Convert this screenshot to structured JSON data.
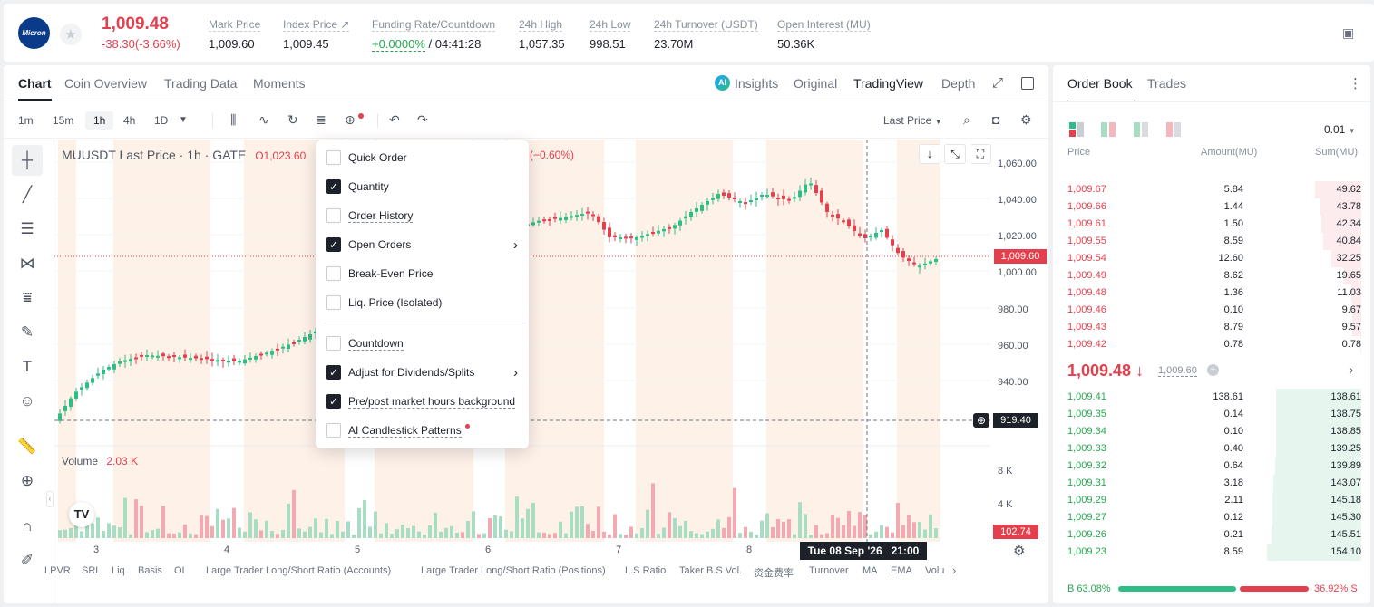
{
  "ticker": {
    "logo_text": "Micron",
    "last_price": "1,009.48",
    "change": "-38.30(-3.66%)",
    "stats": [
      {
        "label": "Mark Price",
        "value": "1,009.60"
      },
      {
        "label": "Index Price ↗",
        "value": "1,009.45"
      },
      {
        "label": "Funding Rate/Countdown",
        "value_green": "+0.0000%",
        "value_rest": " / 04:41:28"
      },
      {
        "label": "24h High",
        "value": "1,057.35"
      },
      {
        "label": "24h Low",
        "value": "998.51"
      },
      {
        "label": "24h Turnover (USDT)",
        "value": "23.70M"
      },
      {
        "label": "Open Interest (MU)",
        "value": "50.36K"
      }
    ]
  },
  "chart_tabs": [
    "Chart",
    "Coin Overview",
    "Trading Data",
    "Moments"
  ],
  "view_tabs": {
    "insights": "Insights",
    "original": "Original",
    "tradingview": "TradingView",
    "depth": "Depth"
  },
  "timeframes": [
    "1m",
    "15m",
    "1h",
    "4h",
    "1D"
  ],
  "price_type": "Last Price",
  "legend": {
    "symbol": "MUUSDT Last Price · 1h · GATE",
    "open": "O1,023.60",
    "change": "(−0.60%)",
    "volume_label": "Volume",
    "volume_value": "2.03 K"
  },
  "y_axis": [
    "1,060.00",
    "1,040.00",
    "1,020.00",
    "1,000.00",
    "980.00",
    "960.00",
    "940.00"
  ],
  "volume_axis": [
    "8 K",
    "4 K"
  ],
  "price_tags": {
    "last": "1,009.60",
    "cross": "919.40",
    "volume": "102.74"
  },
  "x_axis": [
    "3",
    "4",
    "5",
    "6",
    "7",
    "8"
  ],
  "crosshair_time": "Tue 08 Sep '26   21:00",
  "indicators": [
    "LPVR",
    "SRL",
    "Liq",
    "Basis",
    "OI",
    "Large Trader Long/Short Ratio (Accounts)",
    "Large Trader Long/Short Ratio (Positions)",
    "L.S Ratio",
    "Taker B.S Vol.",
    "资金费率",
    "Turnover",
    "MA",
    "EMA",
    "Volu"
  ],
  "menu": [
    {
      "label": "Quick Order",
      "checked": false
    },
    {
      "label": "Quantity",
      "checked": true
    },
    {
      "label": "Order History",
      "checked": false
    },
    {
      "label": "Open Orders",
      "checked": true
    },
    {
      "label": "Break-Even Price",
      "checked": false
    },
    {
      "label": "Liq. Price (Isolated)",
      "checked": false
    },
    {
      "label": "Countdown",
      "checked": false
    },
    {
      "label": "Adjust for Dividends/Splits",
      "checked": true
    },
    {
      "label": "Pre/post market hours background",
      "checked": true
    },
    {
      "label": "AI Candlestick Patterns",
      "checked": false
    }
  ],
  "orderbook": {
    "tabs": [
      "Order Book",
      "Trades"
    ],
    "precision": "0.01",
    "headers": {
      "price": "Price",
      "amount": "Amount(MU)",
      "sum": "Sum(MU)"
    },
    "asks": [
      {
        "price": "1,009.67",
        "amount": "5.84",
        "sum": "49.62",
        "depth": 0.49
      },
      {
        "price": "1,009.66",
        "amount": "1.44",
        "sum": "43.78",
        "depth": 0.43
      },
      {
        "price": "1,009.61",
        "amount": "1.50",
        "sum": "42.34",
        "depth": 0.42
      },
      {
        "price": "1,009.55",
        "amount": "8.59",
        "sum": "40.84",
        "depth": 0.4
      },
      {
        "price": "1,009.54",
        "amount": "12.60",
        "sum": "32.25",
        "depth": 0.32
      },
      {
        "price": "1,009.49",
        "amount": "8.62",
        "sum": "19.65",
        "depth": 0.19
      },
      {
        "price": "1,009.48",
        "amount": "1.36",
        "sum": "11.03",
        "depth": 0.11
      },
      {
        "price": "1,009.46",
        "amount": "0.10",
        "sum": "9.67",
        "depth": 0.095
      },
      {
        "price": "1,009.43",
        "amount": "8.79",
        "sum": "9.57",
        "depth": 0.094
      },
      {
        "price": "1,009.42",
        "amount": "0.78",
        "sum": "0.78",
        "depth": 0.01
      }
    ],
    "mid_price": "1,009.48 ↓",
    "mark_price": "1,009.60",
    "bids": [
      {
        "price": "1,009.41",
        "amount": "138.61",
        "sum": "138.61",
        "depth": 0.9
      },
      {
        "price": "1,009.35",
        "amount": "0.14",
        "sum": "138.75",
        "depth": 0.9
      },
      {
        "price": "1,009.34",
        "amount": "0.10",
        "sum": "138.85",
        "depth": 0.9
      },
      {
        "price": "1,009.33",
        "amount": "0.40",
        "sum": "139.25",
        "depth": 0.9
      },
      {
        "price": "1,009.32",
        "amount": "0.64",
        "sum": "139.89",
        "depth": 0.91
      },
      {
        "price": "1,009.31",
        "amount": "3.18",
        "sum": "143.07",
        "depth": 0.93
      },
      {
        "price": "1,009.29",
        "amount": "2.11",
        "sum": "145.18",
        "depth": 0.94
      },
      {
        "price": "1,009.27",
        "amount": "0.12",
        "sum": "145.30",
        "depth": 0.94
      },
      {
        "price": "1,009.26",
        "amount": "0.21",
        "sum": "145.51",
        "depth": 0.95
      },
      {
        "price": "1,009.23",
        "amount": "8.59",
        "sum": "154.10",
        "depth": 1.0
      }
    ],
    "buy_ratio": "B 63.08%",
    "sell_ratio": "36.92% S",
    "buy_fraction": 0.6308
  },
  "colors": {
    "up": "#2ebd85",
    "down": "#e3404e",
    "accent": "#1d2129",
    "session_bg": "#fdf1e8"
  }
}
